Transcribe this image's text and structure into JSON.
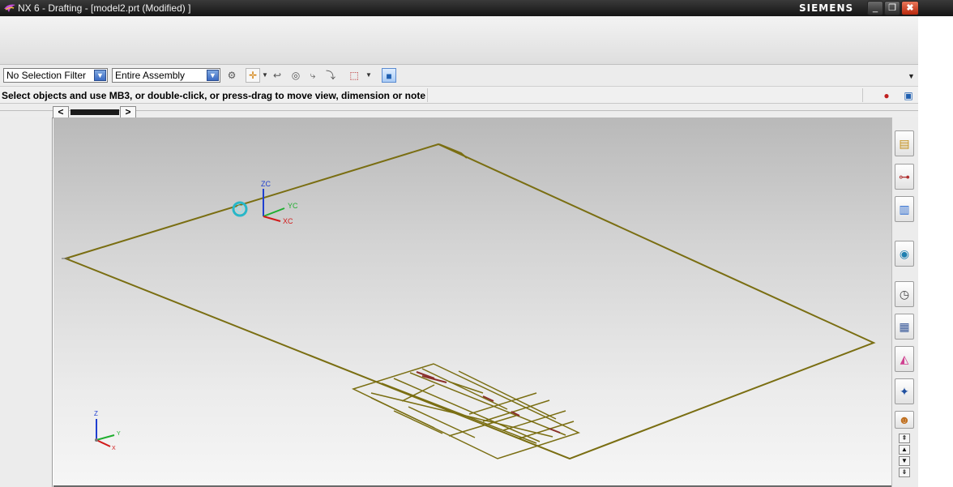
{
  "window": {
    "title": "NX 6 - Drafting - [model2.prt (Modified) ]",
    "brand": "SIEMENS",
    "controls": {
      "minimize": "_",
      "maximize": "❐",
      "close": "✖"
    }
  },
  "selection_bar": {
    "filter_value": "No Selection Filter",
    "scope_value": "Entire Assembly"
  },
  "status": {
    "prompt": "Select objects and use MB3, or double-click, or press-drag to move view, dimension or note"
  },
  "tab_scroll": {
    "left": "<",
    "right": ">"
  },
  "viewport": {
    "wcs_labels": {
      "z": "ZC",
      "y": "YC",
      "x": "XC"
    },
    "triad_labels": {
      "z": "Z",
      "y": "Y",
      "x": "X"
    },
    "colors": {
      "border": "#7a6e12",
      "wcs_z": "#1f3fd0",
      "wcs_y": "#1fae2f",
      "wcs_x": "#d11a1a",
      "cursor": "#28b7c8"
    }
  },
  "resource_bar": {
    "icons": [
      "assembly-navigator-icon",
      "part-navigator-icon",
      "reuse-library-icon",
      "web-browser-icon",
      "history-icon",
      "system-materials-icon",
      "palette-icon",
      "roles-icon",
      "user-icon"
    ]
  }
}
